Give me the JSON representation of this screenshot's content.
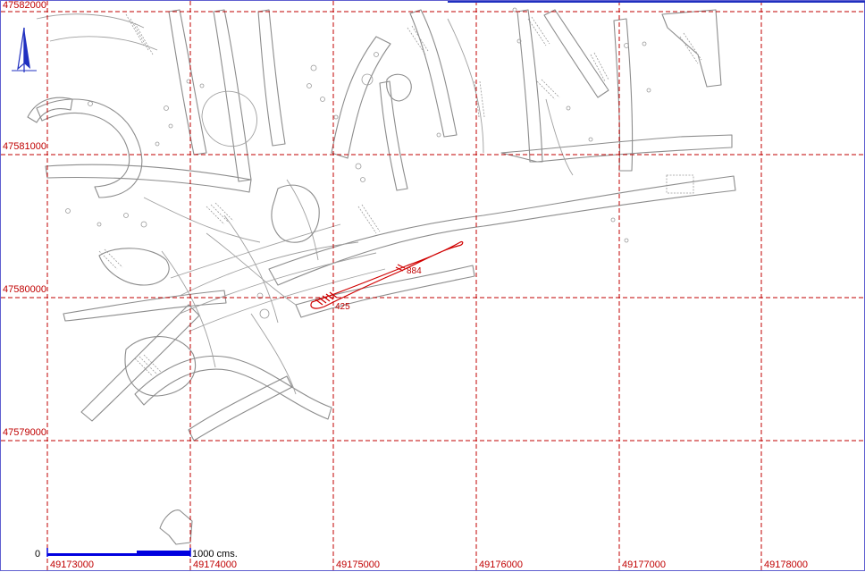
{
  "map": {
    "grid_color": "#c00000",
    "cave_color": "#8c8c8c",
    "highlight_color": "#d00000",
    "north_arrow_color": "#2030c0",
    "scale_bar_color": "#0000e0"
  },
  "grid": {
    "eastings": [
      "49173000",
      "49174000",
      "49175000",
      "49176000",
      "49177000",
      "49178000"
    ],
    "northings": [
      "47582000",
      "47581000",
      "47580000",
      "47579000"
    ]
  },
  "highlight_labels": [
    "884",
    "425"
  ],
  "scale_bar": {
    "start_label": "0",
    "end_label": "1000 cms."
  },
  "north_arrow": {
    "icon": "north-arrow-icon"
  }
}
